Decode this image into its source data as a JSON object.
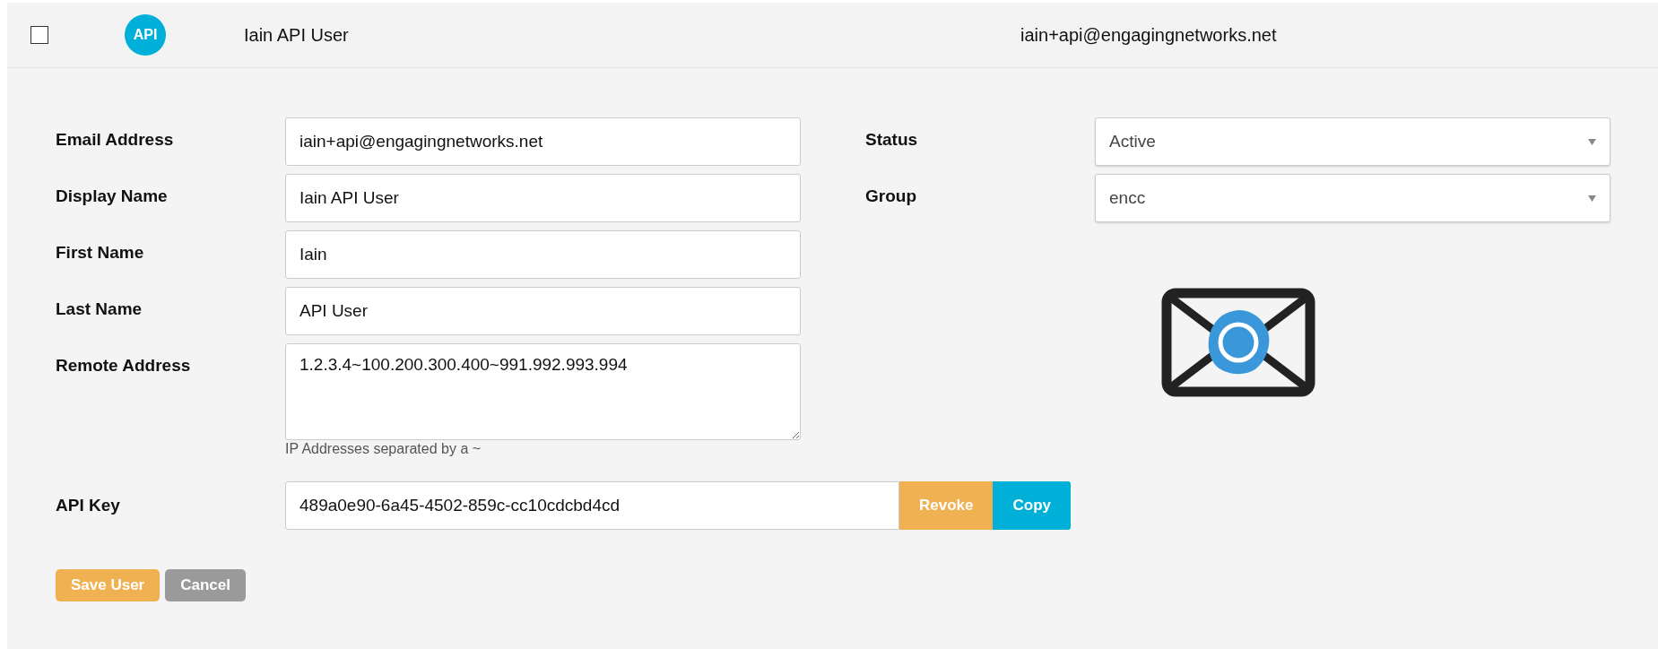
{
  "user_row": {
    "checked": false,
    "badge": "API",
    "name": "Iain API User",
    "email": "iain+api@engagingnetworks.net"
  },
  "form": {
    "fields": [
      {
        "label": "Email Address",
        "value": "iain+api@engagingnetworks.net"
      },
      {
        "label": "Display Name",
        "value": "Iain API User"
      },
      {
        "label": "First Name",
        "value": "Iain"
      },
      {
        "label": "Last Name",
        "value": "API User"
      }
    ],
    "remote_address": {
      "label": "Remote Address",
      "value": "1.2.3.4~100.200.300.400~991.992.993.994",
      "help": "IP Addresses separated by a ~"
    },
    "selects": [
      {
        "label": "Status",
        "value": "Active"
      },
      {
        "label": "Group",
        "value": "encc"
      }
    ],
    "api_key": {
      "label": "API Key",
      "value": "489a0e90-6a45-4502-859c-cc10cdcbd4cd",
      "buttons": [
        {
          "label": "Revoke",
          "kind": "warning"
        },
        {
          "label": "Copy",
          "kind": "info"
        }
      ]
    },
    "actions": [
      {
        "label": "Save User",
        "kind": "primary"
      },
      {
        "label": "Cancel",
        "kind": "secondary"
      }
    ]
  }
}
